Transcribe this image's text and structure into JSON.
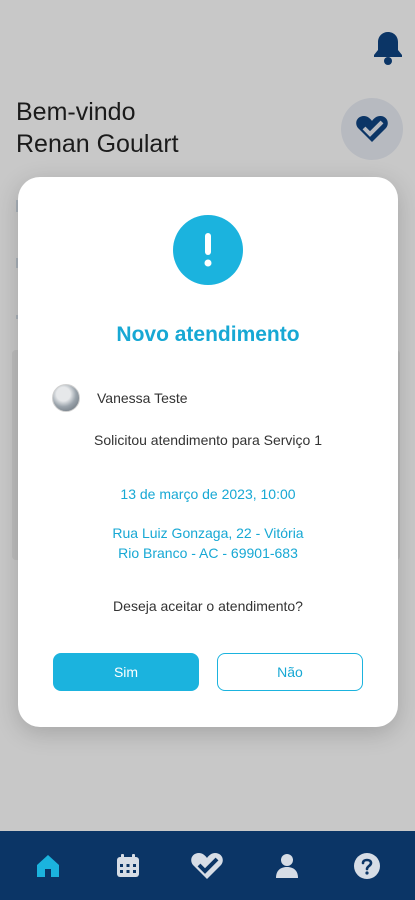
{
  "header": {
    "welcome_line1": "Bem-vindo",
    "welcome_line2": "Renan Goulart"
  },
  "modal": {
    "title": "Novo atendimento",
    "user_name": "Vanessa Teste",
    "request_text": "Solicitou atendimento para Serviço 1",
    "datetime": "13 de março de 2023, 10:00",
    "address_line1": "Rua Luiz Gonzaga, 22 - Vitória",
    "address_line2": "Rio Branco - AC - 69901-683",
    "question": "Deseja aceitar o atendimento?",
    "accept_label": "Sim",
    "decline_label": "Não"
  },
  "nav": {
    "items": [
      {
        "icon": "home-icon"
      },
      {
        "icon": "calendar-icon"
      },
      {
        "icon": "heart-icon"
      },
      {
        "icon": "profile-icon"
      },
      {
        "icon": "help-icon"
      }
    ]
  },
  "colors": {
    "accent": "#1bb3de",
    "nav_bg": "#0b3566",
    "overlay": "#c8c8c8"
  }
}
